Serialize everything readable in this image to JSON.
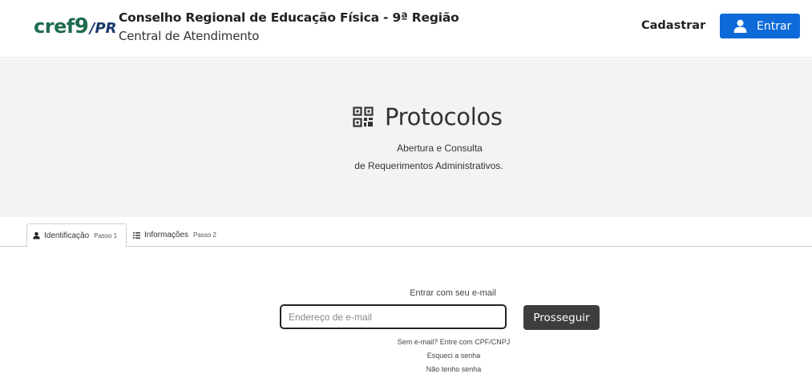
{
  "header": {
    "logo": {
      "cref": "cref",
      "number": "9",
      "uf": "/PR"
    },
    "org_name": "Conselho Regional de Educação Física - 9ª Região",
    "org_subtitle": "Central de Atendimento",
    "register_label": "Cadastrar",
    "login_label": "Entrar",
    "login_icon": "user-icon",
    "accent": "#0d6ad8",
    "brand_green": "#1f6b4e"
  },
  "hero": {
    "icon": "qr-code-icon",
    "title": "Protocolos",
    "desc_line1": "Abertura e Consulta",
    "desc_line2": "de Requerimentos Administrativos."
  },
  "tabs": [
    {
      "icon": "user-icon",
      "label": "Identificação",
      "step": "Passo 1",
      "active": true
    },
    {
      "icon": "list-icon",
      "label": "Informações",
      "step": "Passo 2",
      "active": false
    }
  ],
  "form": {
    "label": "Entrar com seu e-mail",
    "email_placeholder": "Endereço de e-mail",
    "email_value": "",
    "submit_label": "Prosseguir",
    "links": {
      "no_email": "Sem e-mail? Entre com CPF/CNPJ",
      "forgot": "Esqueci a senha",
      "no_password": "Não tenho senha"
    }
  }
}
